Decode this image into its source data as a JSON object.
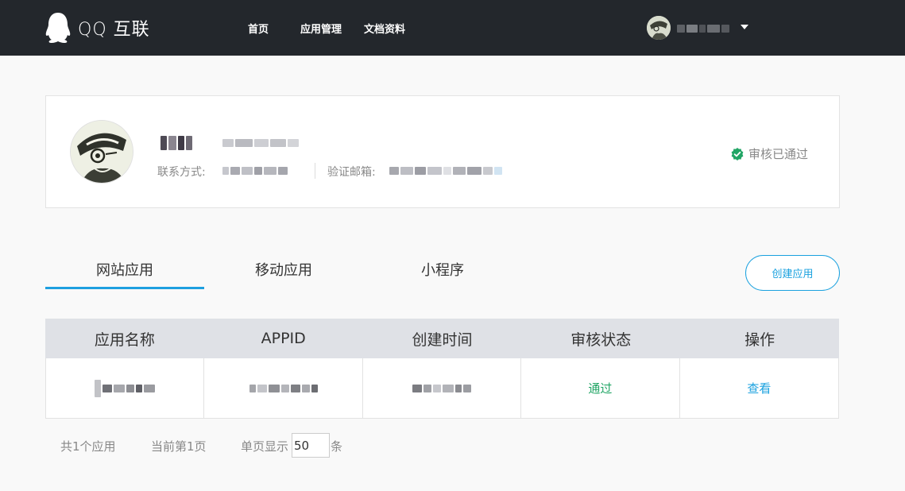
{
  "header": {
    "logo_text": "QQ 互联",
    "nav": [
      {
        "label": "首页"
      },
      {
        "label": "应用管理"
      },
      {
        "label": "文档资料"
      }
    ]
  },
  "profile": {
    "contact_label": "联系方式:",
    "email_label": "验证邮箱:",
    "status_text": "审核已通过",
    "status_color": "#21a565"
  },
  "tabs": [
    {
      "label": "网站应用",
      "active": true
    },
    {
      "label": "移动应用"
    },
    {
      "label": "小程序"
    }
  ],
  "create_button_label": "创建应用",
  "table": {
    "headers": [
      "应用名称",
      "APPID",
      "创建时间",
      "审核状态",
      "操作"
    ],
    "rows": [
      {
        "status": "通过",
        "action": "查看"
      }
    ]
  },
  "footer": {
    "total": "共1个应用",
    "current_page": "当前第1页",
    "page_size_label": "单页显示",
    "page_size_value": "50",
    "unit": "条"
  },
  "colors": {
    "accent": "#1aa1df",
    "header_bg": "#23272c",
    "success": "#21a565"
  }
}
